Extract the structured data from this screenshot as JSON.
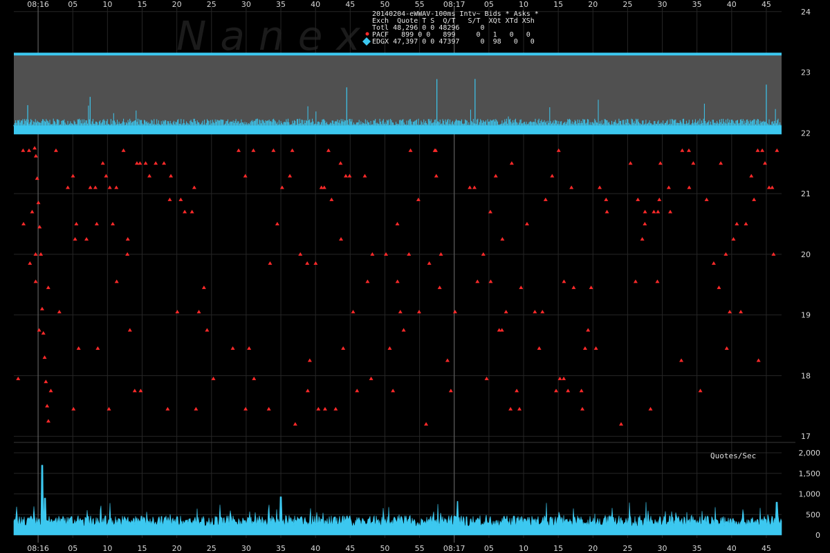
{
  "chart_data": {
    "type": "scatter",
    "title": "20140204-eWWAV-100ms Intv~ Bids * Asks *",
    "watermark": "Nanex",
    "colors": {
      "background": "#000000",
      "edgx": "#3cc8f0",
      "pacf": "#ff2a2a",
      "grid": "#262626",
      "band": "#505050",
      "text": "#d8d8d8"
    },
    "legend": {
      "header": "Exch  Quote T S  Q/T   S/T  XQt XTd XSh",
      "rows": [
        {
          "exch": "Totl",
          "text": "Totl 48,296 0 0 48296     0"
        },
        {
          "exch": "PACF",
          "text": "PACF   899 0 0   899     0   1   0   0",
          "marker": "red-dot"
        },
        {
          "exch": "EDGX",
          "text": "EDGX 47,397 0 0 47397     0  98   0   0",
          "marker": "blue-diamond"
        }
      ]
    },
    "x_axis": {
      "tick_labels": [
        "08:16",
        "05",
        "10",
        "15",
        "20",
        "25",
        "30",
        "35",
        "40",
        "45",
        "50",
        "55",
        "08:17",
        "05",
        "10",
        "15",
        "20",
        "25",
        "30",
        "35",
        "40",
        "45"
      ],
      "tick_seconds": [
        0,
        5,
        10,
        15,
        20,
        25,
        30,
        35,
        40,
        45,
        50,
        55,
        60,
        65,
        70,
        75,
        80,
        85,
        90,
        95,
        100,
        105
      ],
      "range_seconds": [
        -3.5,
        107.2
      ],
      "minute_marks": [
        0,
        60
      ]
    },
    "price_axis": {
      "range": [
        16.9,
        24.1
      ],
      "ticks": [
        17,
        18,
        19,
        20,
        21,
        22,
        23,
        24
      ]
    },
    "edgx_band": {
      "bottom": 22.0,
      "top": 23.3,
      "spread_level": 22.1
    },
    "pacf_ask_levels": [
      21.71,
      21.5,
      21.29,
      21.1,
      20.9,
      20.7,
      20.5,
      20.25,
      20.0,
      19.85,
      19.55,
      19.45,
      19.05,
      18.75,
      18.45,
      18.25,
      17.95,
      17.75,
      17.45,
      17.2
    ],
    "quote_rate": {
      "label": "Quotes/Sec",
      "ylim": [
        0,
        2000
      ],
      "ticks": [
        {
          "v": 0,
          "label": "0"
        },
        {
          "v": 500,
          "label": "500"
        },
        {
          "v": 1000,
          "label": "1,000"
        },
        {
          "v": 1500,
          "label": "1,500"
        },
        {
          "v": 2000,
          "label": "2,000"
        }
      ],
      "baseline": 380,
      "peaks": [
        {
          "t": 0.6,
          "v": 1700
        },
        {
          "t": 1.0,
          "v": 900
        },
        {
          "t": 35.0,
          "v": 930
        },
        {
          "t": 60.5,
          "v": 820
        },
        {
          "t": 106.5,
          "v": 800
        }
      ]
    }
  }
}
